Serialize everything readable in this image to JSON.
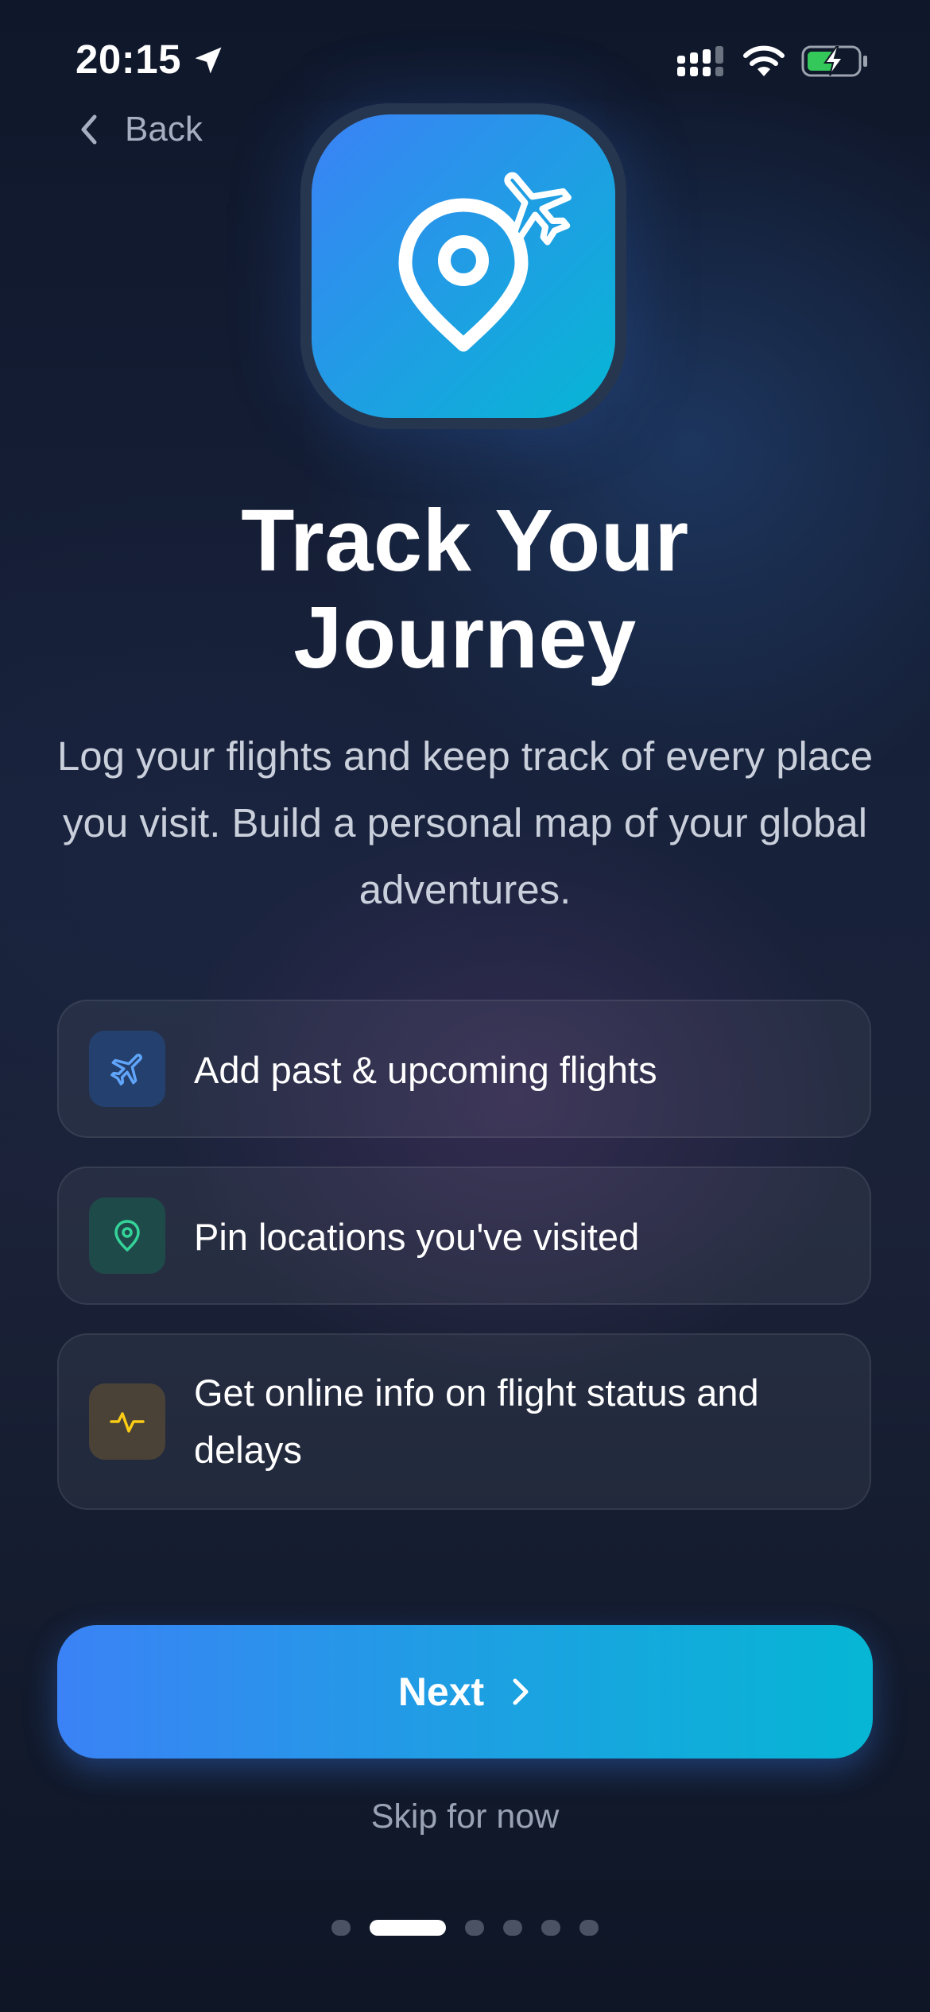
{
  "status_bar": {
    "time": "20:15",
    "icons": [
      "location-arrow-icon",
      "signal-icon",
      "wifi-icon",
      "battery-charging-icon"
    ]
  },
  "nav": {
    "back_label": "Back"
  },
  "hero": {
    "icon": "location-pin-airplane-icon",
    "title_line1": "Track Your",
    "title_line2": "Journey",
    "subtitle": "Log your flights and keep track of every place you visit. Build a personal map of your global adventures."
  },
  "features": [
    {
      "icon": "airplane-icon",
      "color": "#60a5fa",
      "label": "Add past & upcoming flights"
    },
    {
      "icon": "map-pin-icon",
      "color": "#34d399",
      "label": "Pin locations you've visited"
    },
    {
      "icon": "activity-icon",
      "color": "#facc15",
      "label": "Get online info on flight status and delays"
    }
  ],
  "actions": {
    "next_label": "Next",
    "skip_label": "Skip for now"
  },
  "pagination": {
    "total_pages": 6,
    "current_page": 2
  },
  "colors": {
    "accent_start": "#3b82f6",
    "accent_end": "#06b6d4",
    "background": "#111827"
  }
}
